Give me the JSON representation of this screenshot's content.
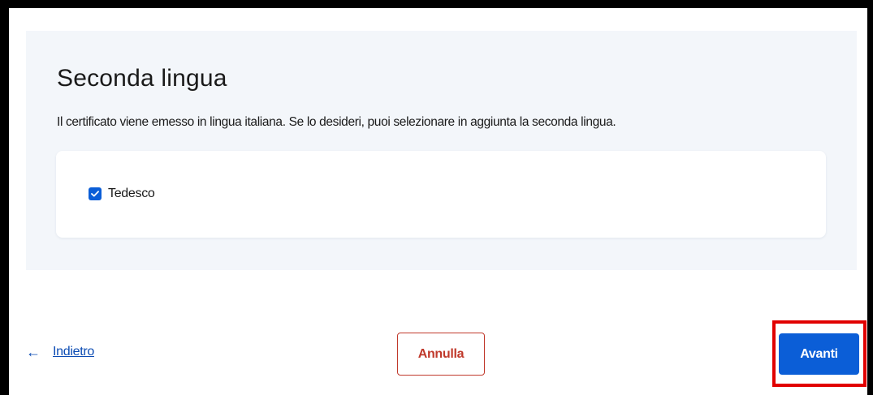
{
  "section": {
    "title": "Seconda lingua",
    "description": "Il certificato viene emesso in lingua italiana. Se lo desideri, puoi selezionare in aggiunta la seconda lingua.",
    "options": [
      {
        "label": "Tedesco",
        "checked": true
      }
    ]
  },
  "footer": {
    "back_arrow": "←",
    "back_label": "Indietro",
    "cancel_label": "Annulla",
    "next_label": "Avanti"
  },
  "colors": {
    "primary": "#0b5ed7",
    "danger": "#c0392b",
    "highlight": "#e10000",
    "panel_background": "#f3f6fa"
  }
}
